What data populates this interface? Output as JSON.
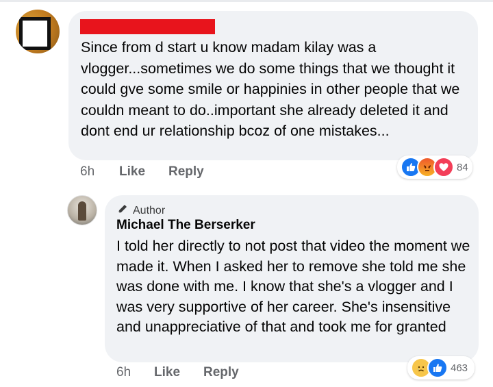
{
  "comment": {
    "text": "Since from d start u know madam kilay was a vlogger...sometimes we do some things that we thought it could gve some smile or happinies in other people that we couldn meant to do..important she already deleted it and dont end ur relationship bcoz of one mistakes...",
    "time": "6h",
    "like_label": "Like",
    "reply_label": "Reply",
    "reaction_icons": [
      "like-icon",
      "angry-icon",
      "love-icon"
    ],
    "reaction_count": "84"
  },
  "reply": {
    "author_badge": "Author",
    "author_name": "Michael The Berserker",
    "text": "I told her directly to not post that video the moment we made it. When I asked her to remove she told me she was done with me. I know that she's a vlogger and I was very supportive of her career. She's insensitive and unappreciative of that and took me for granted",
    "time": "6h",
    "like_label": "Like",
    "reply_label": "Reply",
    "reaction_icons": [
      "sad-icon",
      "like-icon"
    ],
    "reaction_count": "463"
  },
  "colors": {
    "bubble": "#f0f2f5",
    "meta_text": "#65676b",
    "like_blue": "#1877f2",
    "love_red": "#f33e58",
    "redaction": "#e8141c"
  }
}
